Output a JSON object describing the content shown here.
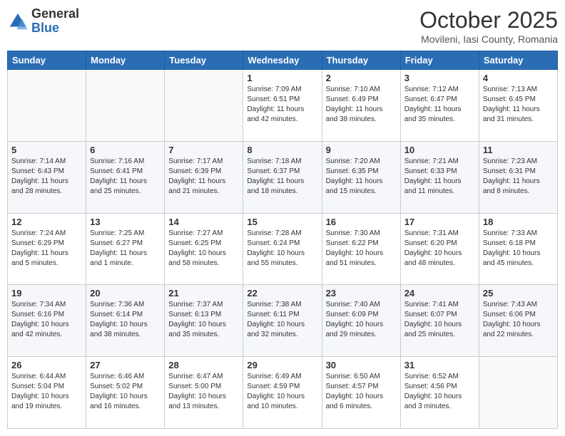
{
  "header": {
    "logo_general": "General",
    "logo_blue": "Blue",
    "month": "October 2025",
    "location": "Movileni, Iasi County, Romania"
  },
  "days_of_week": [
    "Sunday",
    "Monday",
    "Tuesday",
    "Wednesday",
    "Thursday",
    "Friday",
    "Saturday"
  ],
  "weeks": [
    [
      {
        "day": "",
        "info": ""
      },
      {
        "day": "",
        "info": ""
      },
      {
        "day": "",
        "info": ""
      },
      {
        "day": "1",
        "info": "Sunrise: 7:09 AM\nSunset: 6:51 PM\nDaylight: 11 hours\nand 42 minutes."
      },
      {
        "day": "2",
        "info": "Sunrise: 7:10 AM\nSunset: 6:49 PM\nDaylight: 11 hours\nand 38 minutes."
      },
      {
        "day": "3",
        "info": "Sunrise: 7:12 AM\nSunset: 6:47 PM\nDaylight: 11 hours\nand 35 minutes."
      },
      {
        "day": "4",
        "info": "Sunrise: 7:13 AM\nSunset: 6:45 PM\nDaylight: 11 hours\nand 31 minutes."
      }
    ],
    [
      {
        "day": "5",
        "info": "Sunrise: 7:14 AM\nSunset: 6:43 PM\nDaylight: 11 hours\nand 28 minutes."
      },
      {
        "day": "6",
        "info": "Sunrise: 7:16 AM\nSunset: 6:41 PM\nDaylight: 11 hours\nand 25 minutes."
      },
      {
        "day": "7",
        "info": "Sunrise: 7:17 AM\nSunset: 6:39 PM\nDaylight: 11 hours\nand 21 minutes."
      },
      {
        "day": "8",
        "info": "Sunrise: 7:18 AM\nSunset: 6:37 PM\nDaylight: 11 hours\nand 18 minutes."
      },
      {
        "day": "9",
        "info": "Sunrise: 7:20 AM\nSunset: 6:35 PM\nDaylight: 11 hours\nand 15 minutes."
      },
      {
        "day": "10",
        "info": "Sunrise: 7:21 AM\nSunset: 6:33 PM\nDaylight: 11 hours\nand 11 minutes."
      },
      {
        "day": "11",
        "info": "Sunrise: 7:23 AM\nSunset: 6:31 PM\nDaylight: 11 hours\nand 8 minutes."
      }
    ],
    [
      {
        "day": "12",
        "info": "Sunrise: 7:24 AM\nSunset: 6:29 PM\nDaylight: 11 hours\nand 5 minutes."
      },
      {
        "day": "13",
        "info": "Sunrise: 7:25 AM\nSunset: 6:27 PM\nDaylight: 11 hours\nand 1 minute."
      },
      {
        "day": "14",
        "info": "Sunrise: 7:27 AM\nSunset: 6:25 PM\nDaylight: 10 hours\nand 58 minutes."
      },
      {
        "day": "15",
        "info": "Sunrise: 7:28 AM\nSunset: 6:24 PM\nDaylight: 10 hours\nand 55 minutes."
      },
      {
        "day": "16",
        "info": "Sunrise: 7:30 AM\nSunset: 6:22 PM\nDaylight: 10 hours\nand 51 minutes."
      },
      {
        "day": "17",
        "info": "Sunrise: 7:31 AM\nSunset: 6:20 PM\nDaylight: 10 hours\nand 48 minutes."
      },
      {
        "day": "18",
        "info": "Sunrise: 7:33 AM\nSunset: 6:18 PM\nDaylight: 10 hours\nand 45 minutes."
      }
    ],
    [
      {
        "day": "19",
        "info": "Sunrise: 7:34 AM\nSunset: 6:16 PM\nDaylight: 10 hours\nand 42 minutes."
      },
      {
        "day": "20",
        "info": "Sunrise: 7:36 AM\nSunset: 6:14 PM\nDaylight: 10 hours\nand 38 minutes."
      },
      {
        "day": "21",
        "info": "Sunrise: 7:37 AM\nSunset: 6:13 PM\nDaylight: 10 hours\nand 35 minutes."
      },
      {
        "day": "22",
        "info": "Sunrise: 7:38 AM\nSunset: 6:11 PM\nDaylight: 10 hours\nand 32 minutes."
      },
      {
        "day": "23",
        "info": "Sunrise: 7:40 AM\nSunset: 6:09 PM\nDaylight: 10 hours\nand 29 minutes."
      },
      {
        "day": "24",
        "info": "Sunrise: 7:41 AM\nSunset: 6:07 PM\nDaylight: 10 hours\nand 25 minutes."
      },
      {
        "day": "25",
        "info": "Sunrise: 7:43 AM\nSunset: 6:06 PM\nDaylight: 10 hours\nand 22 minutes."
      }
    ],
    [
      {
        "day": "26",
        "info": "Sunrise: 6:44 AM\nSunset: 5:04 PM\nDaylight: 10 hours\nand 19 minutes."
      },
      {
        "day": "27",
        "info": "Sunrise: 6:46 AM\nSunset: 5:02 PM\nDaylight: 10 hours\nand 16 minutes."
      },
      {
        "day": "28",
        "info": "Sunrise: 6:47 AM\nSunset: 5:00 PM\nDaylight: 10 hours\nand 13 minutes."
      },
      {
        "day": "29",
        "info": "Sunrise: 6:49 AM\nSunset: 4:59 PM\nDaylight: 10 hours\nand 10 minutes."
      },
      {
        "day": "30",
        "info": "Sunrise: 6:50 AM\nSunset: 4:57 PM\nDaylight: 10 hours\nand 6 minutes."
      },
      {
        "day": "31",
        "info": "Sunrise: 6:52 AM\nSunset: 4:56 PM\nDaylight: 10 hours\nand 3 minutes."
      },
      {
        "day": "",
        "info": ""
      }
    ]
  ]
}
